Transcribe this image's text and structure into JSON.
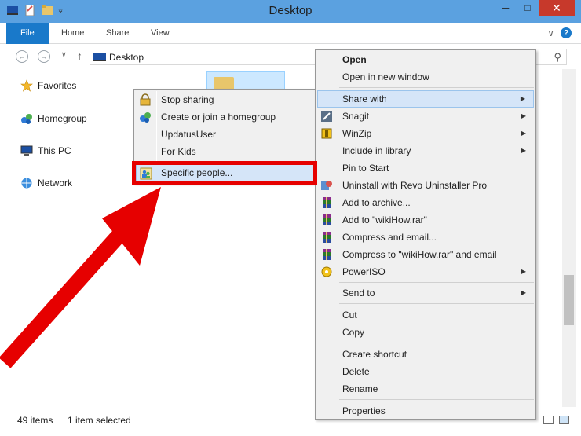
{
  "window": {
    "title": "Desktop"
  },
  "ribbon": {
    "tabs": [
      {
        "label": "File"
      },
      {
        "label": "Home"
      },
      {
        "label": "Share"
      },
      {
        "label": "View"
      }
    ],
    "expand": "∨",
    "help": "?"
  },
  "controls": {
    "minimize": "─",
    "maximize": "□",
    "close": "✕"
  },
  "address": {
    "path": "Desktop",
    "back": "←",
    "forward": "→",
    "up": "↑",
    "dropdown": "∨"
  },
  "search": {
    "icon": "⚲"
  },
  "sidebar": {
    "items": [
      {
        "label": "Favorites",
        "icon": "star-icon"
      },
      {
        "label": "Homegroup",
        "icon": "homegroup-icon"
      },
      {
        "label": "This PC",
        "icon": "computer-icon"
      },
      {
        "label": "Network",
        "icon": "network-icon"
      }
    ]
  },
  "status": {
    "items": "49 items",
    "selected": "1 item selected"
  },
  "submenu": {
    "items": [
      {
        "label": "Stop sharing",
        "icon": "lock-icon"
      },
      {
        "label": "Create or join a homegroup",
        "icon": "homegroup-icon"
      },
      {
        "label": "UpdatusUser"
      },
      {
        "label": "For Kids"
      },
      {
        "label": "Specific people...",
        "icon": "people-icon",
        "highlighted": true
      }
    ]
  },
  "context_menu": {
    "items": [
      {
        "label": "Open",
        "bold": true
      },
      {
        "label": "Open in new window"
      },
      {
        "label": "Share with",
        "submenu": true,
        "highlighted": true
      },
      {
        "label": "Snagit",
        "submenu": true,
        "icon": "snagit-icon"
      },
      {
        "label": "WinZip",
        "submenu": true,
        "icon": "winzip-icon"
      },
      {
        "label": "Include in library",
        "submenu": true
      },
      {
        "label": "Pin to Start"
      },
      {
        "label": "Uninstall with Revo Uninstaller Pro",
        "icon": "revo-icon"
      },
      {
        "label": "Add to archive...",
        "icon": "winrar-icon"
      },
      {
        "label": "Add to \"wikiHow.rar\"",
        "icon": "winrar-icon"
      },
      {
        "label": "Compress and email...",
        "icon": "winrar-icon"
      },
      {
        "label": "Compress to \"wikiHow.rar\" and email",
        "icon": "winrar-icon"
      },
      {
        "label": "PowerISO",
        "submenu": true,
        "icon": "poweriso-icon"
      },
      {
        "label": "Send to",
        "submenu": true
      },
      {
        "label": "Cut"
      },
      {
        "label": "Copy"
      },
      {
        "label": "Create shortcut"
      },
      {
        "label": "Delete"
      },
      {
        "label": "Rename"
      },
      {
        "label": "Properties"
      }
    ],
    "submenu_arrow": "▶"
  },
  "colors": {
    "titlebar": "#5ba1e0",
    "file_tab": "#1979ca",
    "highlight": "#d5e5f8",
    "annotation_red": "#e60000"
  }
}
